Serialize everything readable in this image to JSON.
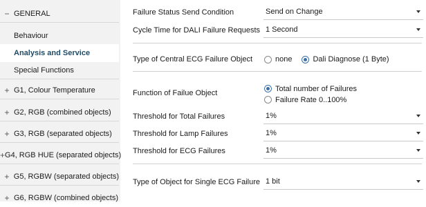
{
  "sidebar": {
    "items": [
      {
        "sign": "−",
        "label": "GENERAL"
      },
      {
        "label": "Behaviour"
      },
      {
        "label": "Analysis and Service"
      },
      {
        "label": "Special Functions"
      },
      {
        "sign": "+",
        "label": "G1, Colour Temperature"
      },
      {
        "sign": "+",
        "label": "G2, RGB (combined objects)"
      },
      {
        "sign": "+",
        "label": "G3, RGB (separated objects)"
      },
      {
        "sign": "+",
        "label": "G4, RGB HUE (separated objects)"
      },
      {
        "sign": "+",
        "label": "G5, RGBW (separated objects)"
      },
      {
        "sign": "+",
        "label": "G6, RGBW (combined objects)"
      }
    ]
  },
  "form": {
    "failure_status": {
      "label": "Failure Status Send Condition",
      "value": "Send on Change"
    },
    "cycle_time": {
      "label": "Cycle Time for DALI Failure Requests",
      "value": "1 Second"
    },
    "central_ecg": {
      "label": "Type of Central ECG Failure Object",
      "options": [
        "none",
        "Dali Diagnose (1 Byte)"
      ],
      "selected": "Dali Diagnose (1 Byte)"
    },
    "function_failure": {
      "label": "Function of Failue Object",
      "options": [
        "Total number of Failures",
        "Failure Rate 0..100%"
      ],
      "selected": "Total number of Failures"
    },
    "threshold_total": {
      "label": "Threshold for Total Failures",
      "value": "1%"
    },
    "threshold_lamp": {
      "label": "Threshold for Lamp Failures",
      "value": "1%"
    },
    "threshold_ecg": {
      "label": "Threshold for ECG Failures",
      "value": "1%"
    },
    "single_ecg": {
      "label": "Type of Object for Single ECG Failure",
      "value": "1 bit"
    }
  },
  "colors": {
    "accent": "#3a6fa8",
    "selected_text": "#1f4a66",
    "sidebar_bg": "#f2f2f2"
  }
}
